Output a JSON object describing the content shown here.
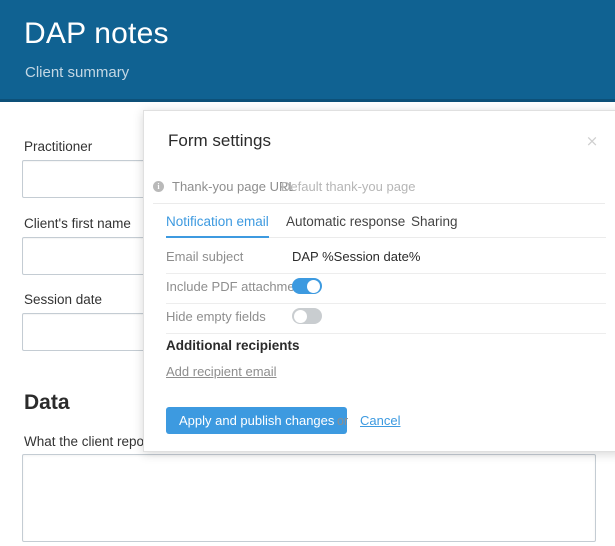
{
  "header": {
    "title": "DAP notes",
    "subtitle": "Client summary",
    "bg_color": "#106292"
  },
  "background_form": {
    "fields": [
      {
        "label": "Practitioner",
        "value": ""
      },
      {
        "label": "Client's first name",
        "value": ""
      },
      {
        "label": "Session date",
        "value": ""
      }
    ],
    "section_title": "Data",
    "data_field_label": "What the client report",
    "data_field_value": ""
  },
  "modal": {
    "title": "Form settings",
    "close_icon": "close-icon",
    "close_glyph": "×",
    "info_icon": "info-icon",
    "info_glyph": "i",
    "thankyou": {
      "label": "Thank-you page URL",
      "value": "Default thank-you page"
    },
    "tabs": [
      {
        "label": "Notification email",
        "active": true
      },
      {
        "label": "Automatic response",
        "active": false
      },
      {
        "label": "Sharing",
        "active": false
      }
    ],
    "settings": [
      {
        "label": "Email subject",
        "type": "text",
        "value": "DAP %Session date%"
      },
      {
        "label": "Include PDF attachment",
        "type": "toggle",
        "state": "on"
      },
      {
        "label": "Hide empty fields",
        "type": "toggle",
        "state": "off"
      }
    ],
    "additional_recipients_title": "Additional recipients",
    "add_recipient_link": "Add recipient email",
    "apply_button": "Apply and publish changes",
    "or_text": "or",
    "cancel_link": "Cancel",
    "accent_color": "#3d9ae0"
  }
}
